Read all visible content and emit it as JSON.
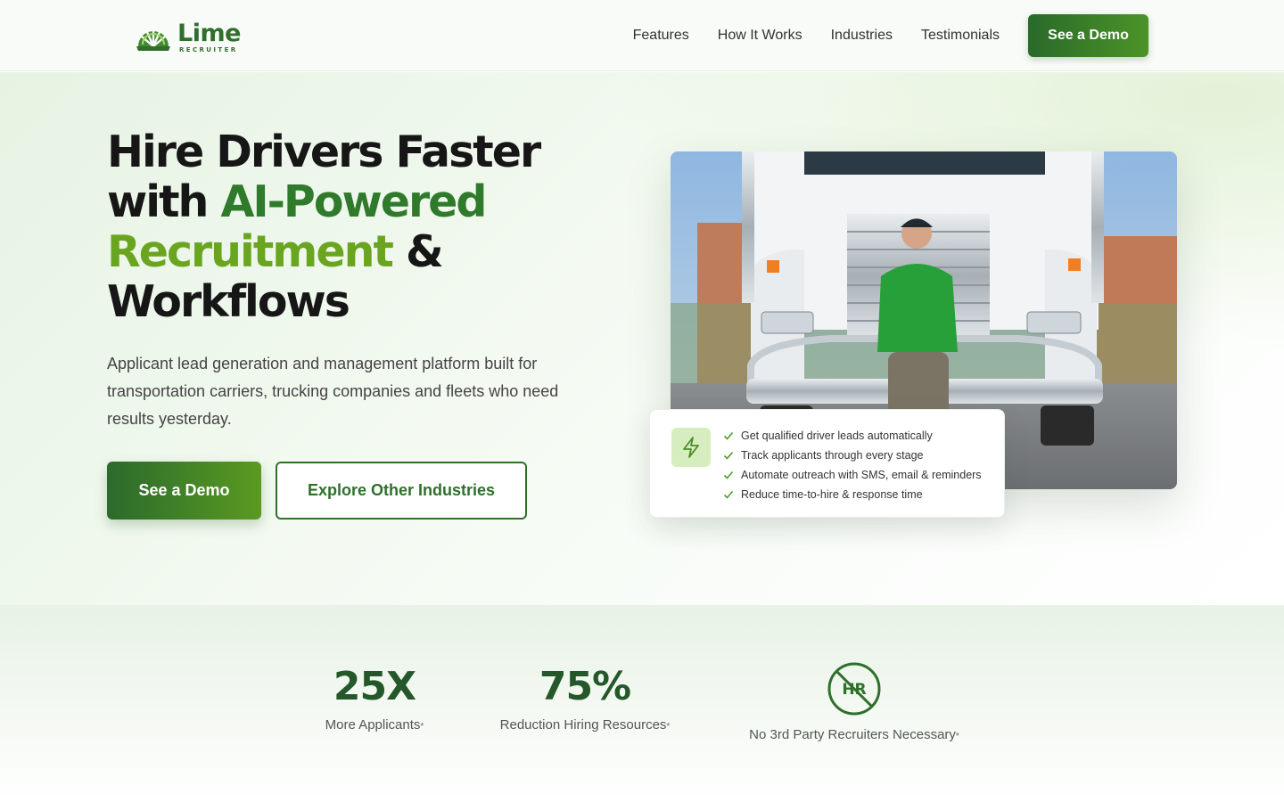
{
  "brand": {
    "name": "Lime",
    "tagline": "RECRUITER",
    "colors": {
      "primary": "#2f6f2b",
      "accent": "#6aa520",
      "dark_text": "#161616"
    }
  },
  "nav": {
    "links": [
      "Features",
      "How It Works",
      "Industries",
      "Testimonials"
    ],
    "cta": "See a Demo"
  },
  "hero": {
    "title": {
      "line1": "Hire Drivers Faster",
      "with": "with ",
      "highlight1": "AI-Powered",
      "highlight2": "Recruitment",
      "amp": " &",
      "line4": "Workflows"
    },
    "description": "Applicant lead generation and management platform built for transportation carriers, trucking companies and fleets who need results yesterday.",
    "primary_button": "See a Demo",
    "secondary_button": "Explore Other Industries",
    "photo_alt_icon": "truck-driver-photo",
    "feature_card": {
      "icon": "lightning-bolt-icon",
      "items": [
        "Get qualified driver leads automatically",
        "Track applicants through every stage",
        "Automate outreach with SMS, email & reminders",
        "Reduce time-to-hire & response time"
      ]
    }
  },
  "stats": [
    {
      "value": "25X",
      "label": "More Applicants",
      "mark": "*"
    },
    {
      "value": "75%",
      "label": "Reduction Hiring Resources",
      "mark": "*"
    },
    {
      "icon_text": "HR",
      "label": "No 3rd Party Recruiters Necessary",
      "mark": "*"
    }
  ]
}
